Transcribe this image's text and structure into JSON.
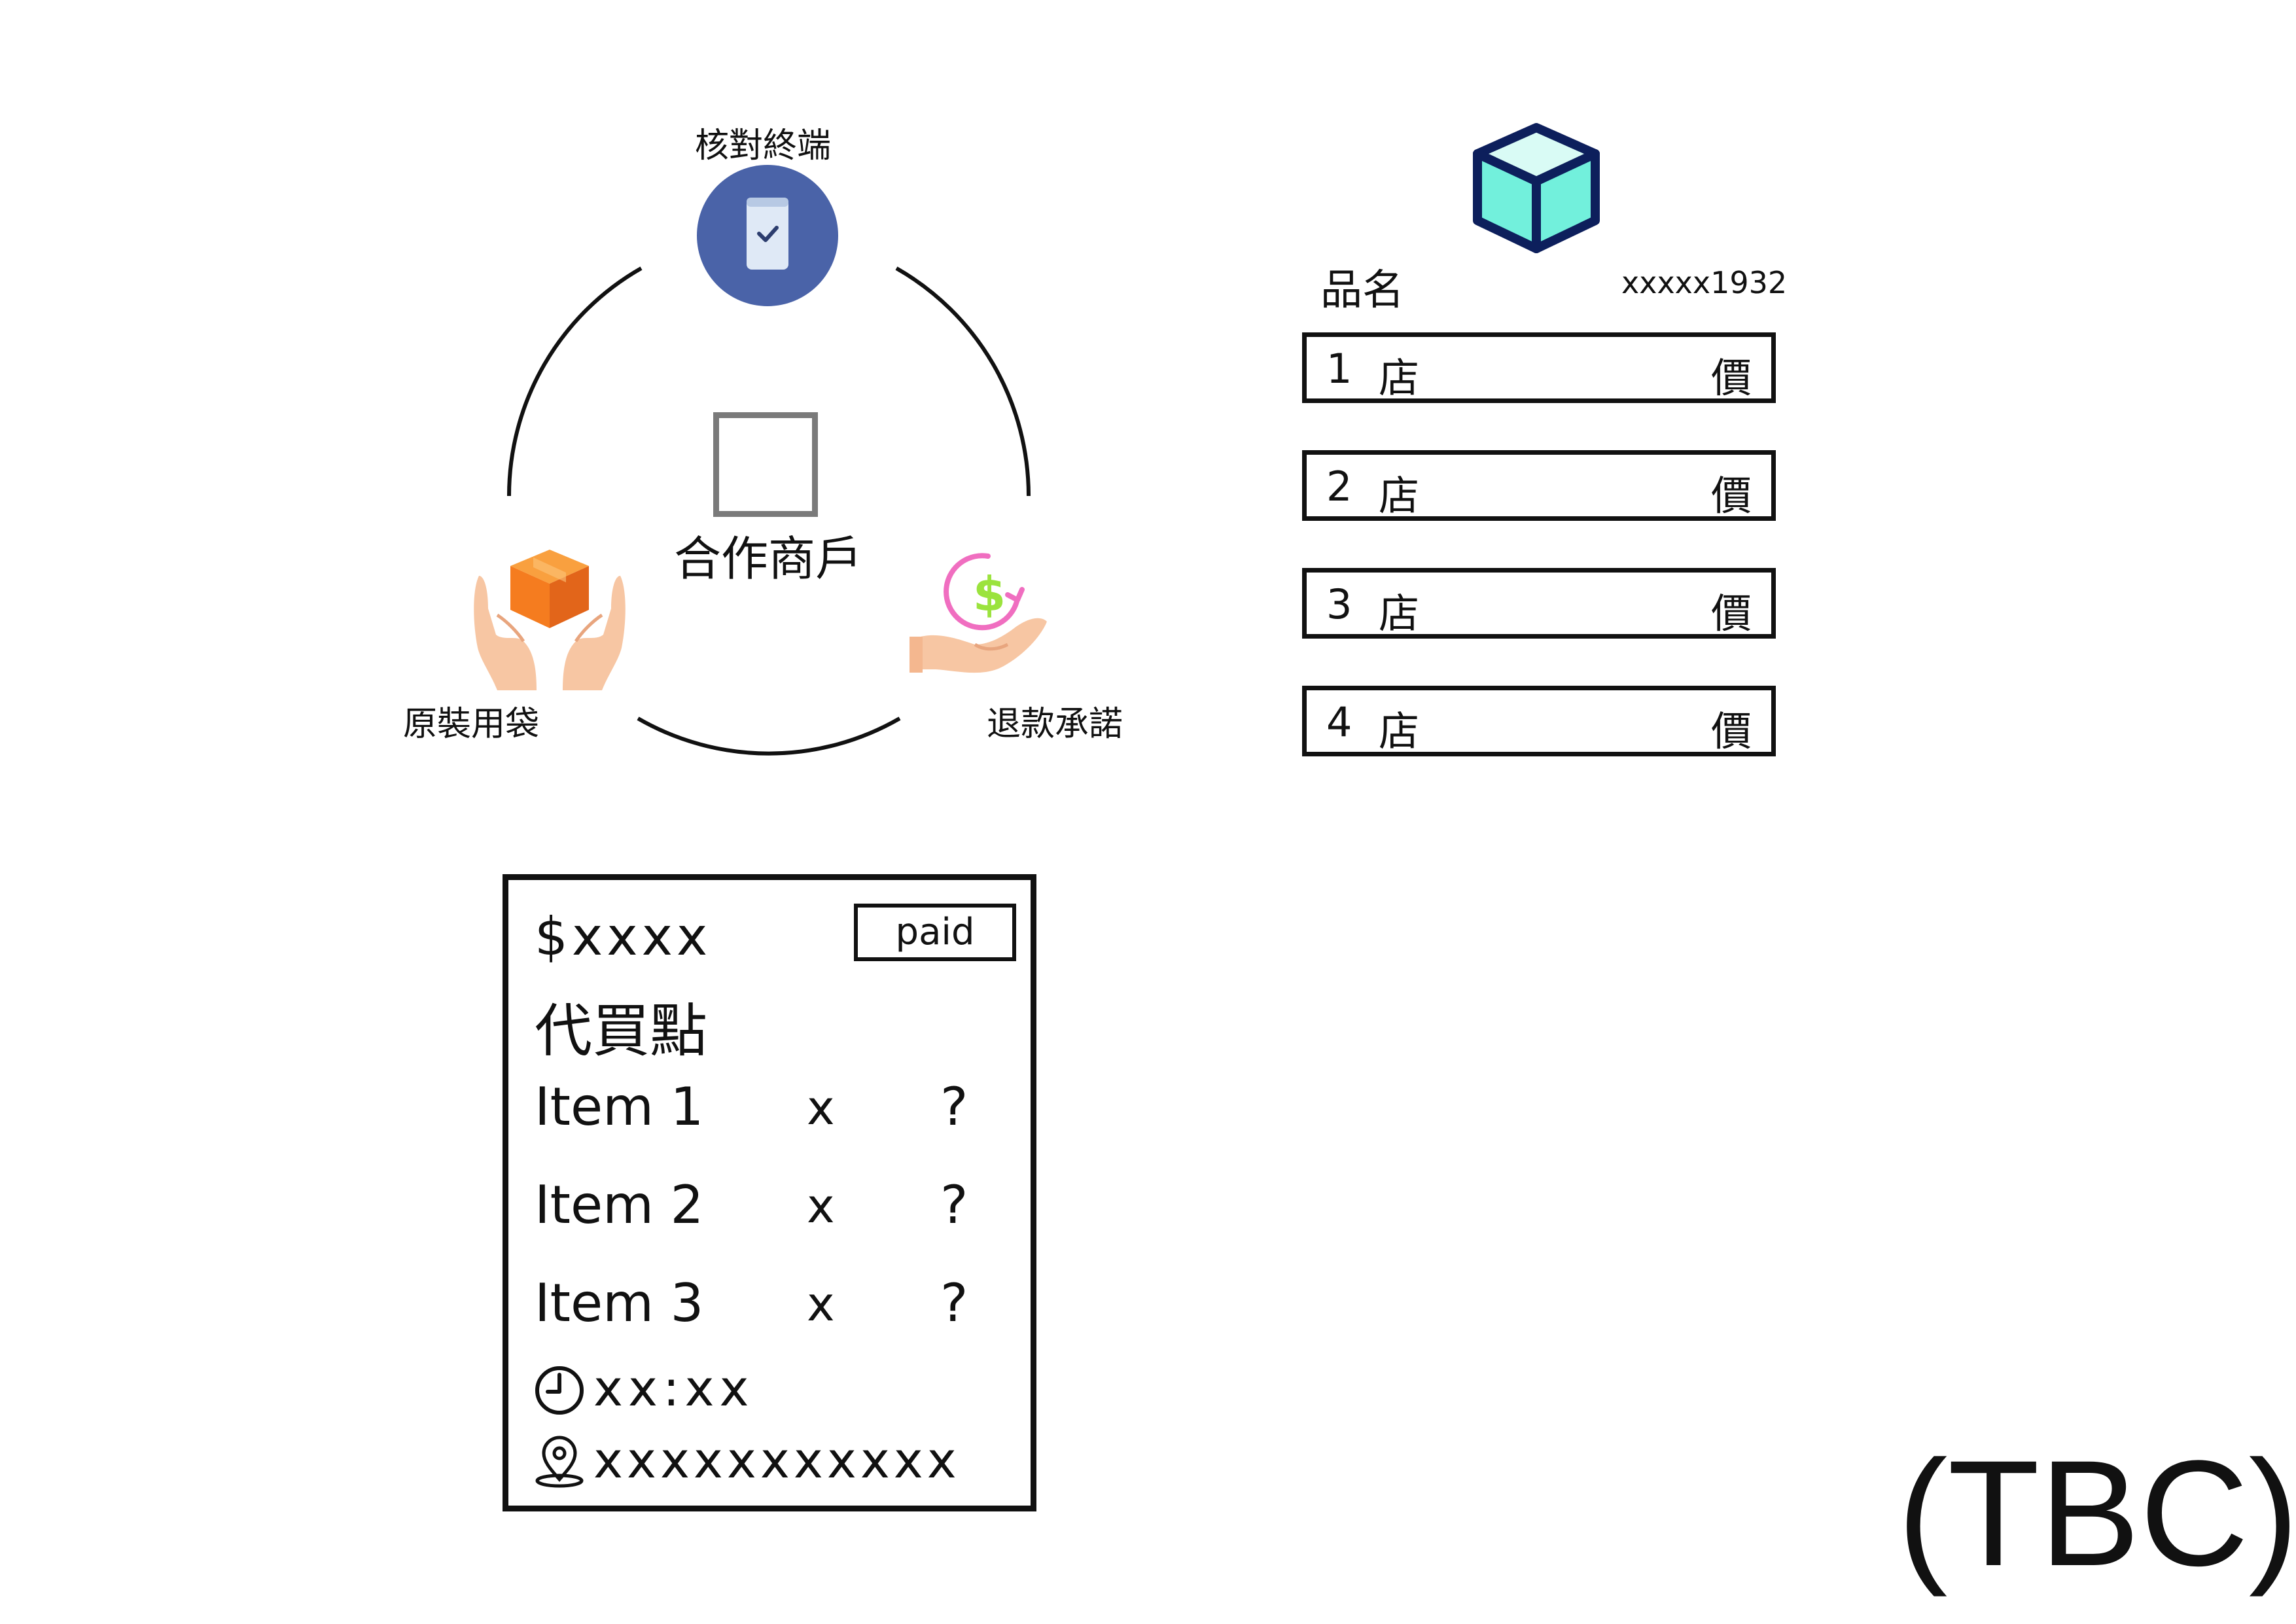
{
  "cycle": {
    "top_node": "核對終端",
    "center": "合作商戶",
    "left_node": "原裝用袋",
    "right_node": "退款承諾"
  },
  "product": {
    "name": "品名",
    "code": "xxxxx1932",
    "stores": [
      {
        "num": "1",
        "label": "店",
        "price": "價"
      },
      {
        "num": "2",
        "label": "店",
        "price": "價"
      },
      {
        "num": "3",
        "label": "店",
        "price": "價"
      },
      {
        "num": "4",
        "label": "店",
        "price": "價"
      }
    ]
  },
  "order": {
    "amount": "$xxxx",
    "status": "paid",
    "title": "代買點",
    "items": [
      {
        "name": "Item 1",
        "x": "x",
        "qty": "?"
      },
      {
        "name": "Item 2",
        "x": "x",
        "qty": "?"
      },
      {
        "name": "Item 3",
        "x": "x",
        "qty": "?"
      }
    ],
    "time": "xx:xx",
    "location": "xxxxxxxxxxx"
  },
  "note": "(TBC)",
  "colors": {
    "terminal_circle": "#4a63a8",
    "box_orange": "#f57c1f",
    "hand_skin": "#f7c6a3",
    "dollar_pink": "#f06ec0",
    "dollar_green": "#9be33d",
    "cube_teal": "#72f0dc",
    "cube_navy": "#0d1f5c"
  }
}
